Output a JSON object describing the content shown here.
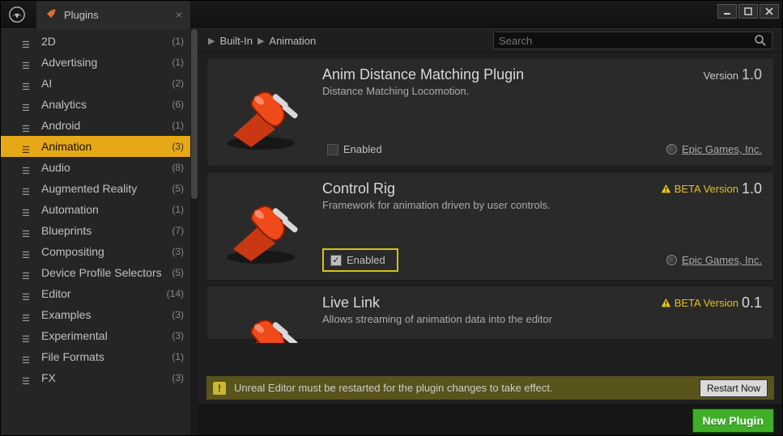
{
  "titlebar": {
    "tab_label": "Plugins"
  },
  "breadcrumb": {
    "root": "Built-In",
    "current": "Animation"
  },
  "search": {
    "placeholder": "Search"
  },
  "sidebar": {
    "items": [
      {
        "label": "2D",
        "count": "(1)"
      },
      {
        "label": "Advertising",
        "count": "(1)"
      },
      {
        "label": "AI",
        "count": "(2)"
      },
      {
        "label": "Analytics",
        "count": "(6)"
      },
      {
        "label": "Android",
        "count": "(1)"
      },
      {
        "label": "Animation",
        "count": "(3)",
        "active": true
      },
      {
        "label": "Audio",
        "count": "(8)"
      },
      {
        "label": "Augmented Reality",
        "count": "(5)"
      },
      {
        "label": "Automation",
        "count": "(1)"
      },
      {
        "label": "Blueprints",
        "count": "(7)"
      },
      {
        "label": "Compositing",
        "count": "(3)"
      },
      {
        "label": "Device Profile Selectors",
        "count": "(5)"
      },
      {
        "label": "Editor",
        "count": "(14)"
      },
      {
        "label": "Examples",
        "count": "(3)"
      },
      {
        "label": "Experimental",
        "count": "(3)"
      },
      {
        "label": "File Formats",
        "count": "(1)"
      },
      {
        "label": "FX",
        "count": "(3)"
      }
    ]
  },
  "plugins": [
    {
      "title": "Anim Distance Matching Plugin",
      "desc": "Distance Matching Locomotion.",
      "version_prefix": "Version",
      "version": "1.0",
      "beta": false,
      "enabled": false,
      "enabled_label": "Enabled",
      "vendor": "Epic Games, Inc."
    },
    {
      "title": "Control Rig",
      "desc": "Framework for animation driven by user controls.",
      "version_prefix": "BETA Version",
      "version": "1.0",
      "beta": true,
      "enabled": true,
      "enabled_label": "Enabled",
      "highlight": true,
      "vendor": "Epic Games, Inc."
    },
    {
      "title": "Live Link",
      "desc": "Allows streaming of animation data into the editor",
      "version_prefix": "BETA Version",
      "version": "0.1",
      "beta": true
    }
  ],
  "restart": {
    "message": "Unreal Editor must be restarted for the plugin changes to take effect.",
    "button": "Restart Now"
  },
  "footer": {
    "new_plugin": "New Plugin"
  }
}
